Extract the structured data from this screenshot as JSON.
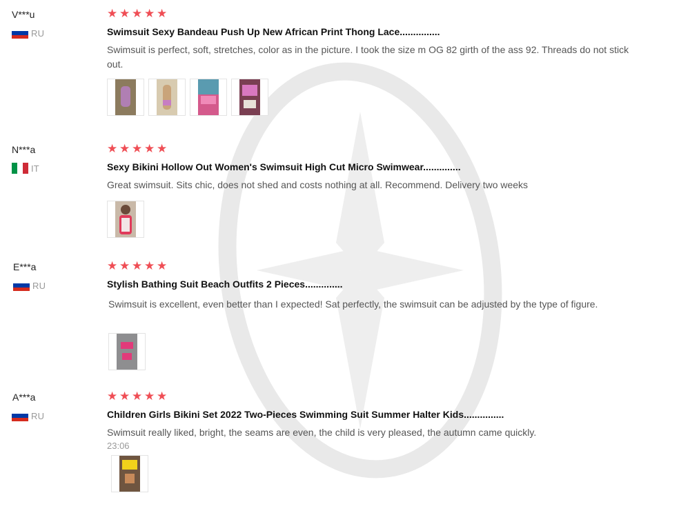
{
  "colors": {
    "star": "#ef4e55",
    "text": "#555555",
    "muted": "#999999"
  },
  "reviews": [
    {
      "name": "V***u",
      "country": "RU",
      "flag": "russia-flag",
      "stars": 5,
      "title": "Swimsuit Sexy Bandeau Push Up New African Print Thong Lace...............",
      "text": "Swimsuit is perfect, soft, stretches, color as in the picture. I took the size m OG 82 girth of the ass 92. Threads do not stick out.",
      "time": "",
      "photos": 4
    },
    {
      "name": "N***a",
      "country": "IT",
      "flag": "italy-flag",
      "stars": 5,
      "title": "Sexy Bikini Hollow Out Women's Swimsuit High Cut Micro Swimwear..............",
      "text": "Great swimsuit. Sits chic, does not shed and costs nothing at all. Recommend. Delivery two weeks",
      "time": "",
      "photos": 1
    },
    {
      "name": "E***a",
      "country": "RU",
      "flag": "russia-flag",
      "stars": 5,
      "title": "Stylish Bathing Suit Beach Outfits 2 Pieces..............",
      "text": "Swimsuit is excellent, even better than I expected! Sat perfectly, the swimsuit can be adjusted by the type of figure.",
      "time": "",
      "photos": 1
    },
    {
      "name": "A***a",
      "country": "RU",
      "flag": "russia-flag",
      "stars": 5,
      "title": "Children Girls Bikini Set 2022 Two-Pieces Swimming Suit Summer Halter Kids...............",
      "text": "Swimsuit really liked, bright, the seams are even, the child is very pleased, the autumn came quickly.",
      "time": "23:06",
      "photos": 1
    }
  ]
}
